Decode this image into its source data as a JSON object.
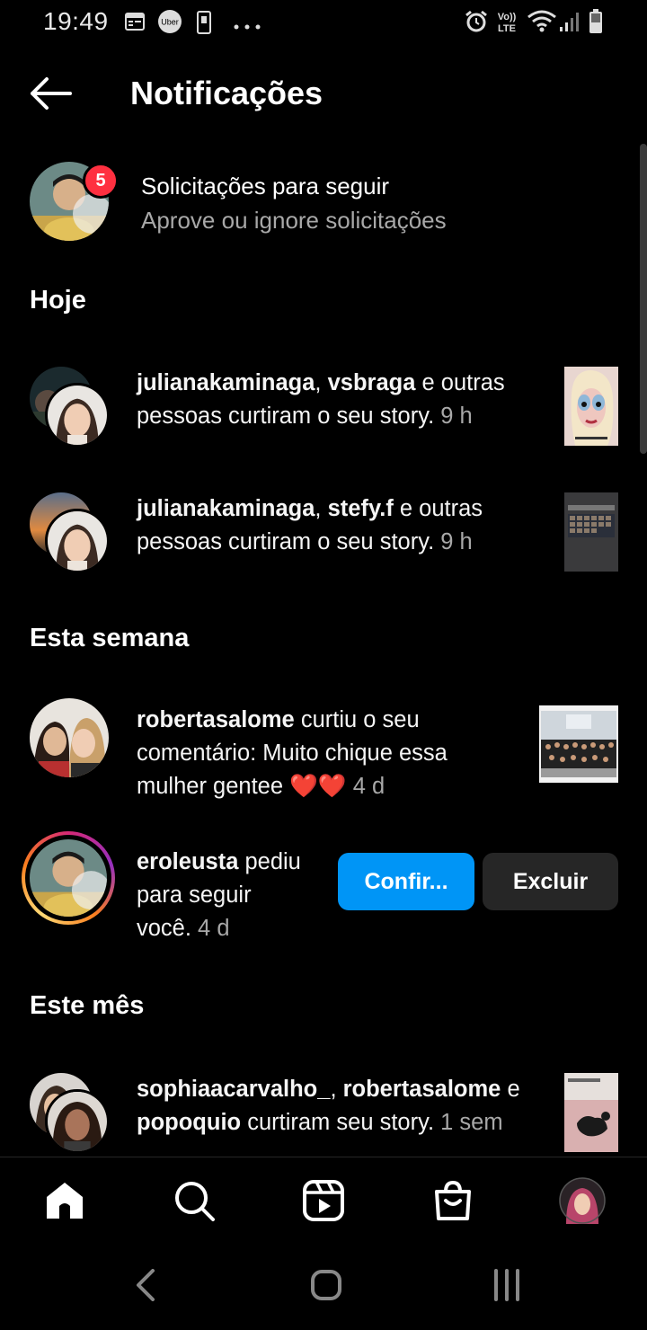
{
  "status_bar": {
    "time": "19:49",
    "icons": [
      "calendar-icon",
      "uber-icon",
      "phone-icon",
      "more-dots-icon",
      "alarm-icon",
      "volte-icon",
      "wifi-icon",
      "signal-icon",
      "battery-icon"
    ],
    "uber_label": "Uber",
    "volte_top": "Vo))",
    "volte_bottom": "LTE"
  },
  "header": {
    "title": "Notificações"
  },
  "follow_requests": {
    "title": "Solicitações para seguir",
    "subtitle": "Aprove ou ignore solicitações",
    "badge_count": "5"
  },
  "sections": {
    "today": "Hoje",
    "this_week": "Esta semana",
    "this_month": "Este mês"
  },
  "notifications": [
    {
      "user1": "julianakaminaga",
      "separator": ", ",
      "user2": "vsbraga",
      "text_a": " e outras",
      "text_b": "pessoas curtiram o seu story. ",
      "time": "9 h"
    },
    {
      "user1": "julianakaminaga",
      "separator": ", ",
      "user2": "stefy.f",
      "text_a": " e outras",
      "text_b": "pessoas curtiram o seu story. ",
      "time": "9 h"
    },
    {
      "user1": "robertasalome",
      "text_a": " curtiu o seu",
      "text_b": "comentário: Muito chique essa",
      "text_c": "mulher gentee ❤️❤️ ",
      "time": "4 d"
    },
    {
      "user1": "eroleusta",
      "text_a": " pediu",
      "text_b": "para seguir",
      "text_c": "você. ",
      "time": "4 d",
      "confirm_label": "Confir...",
      "delete_label": "Excluir"
    },
    {
      "user1": "sophiaacarvalho_",
      "separator": ", ",
      "user2": "robertasalome",
      "text_a": " e",
      "user3": "popoquio",
      "text_b": " curtiram seu story. ",
      "time": "1 sem"
    }
  ],
  "bottom_nav": [
    "home-icon",
    "search-icon",
    "reels-icon",
    "shop-icon",
    "profile-avatar"
  ],
  "colors": {
    "background": "#000000",
    "primary_button": "#0095f6",
    "secondary_button": "#262626",
    "badge": "#ff3040",
    "muted_text": "#a8a8a8"
  }
}
